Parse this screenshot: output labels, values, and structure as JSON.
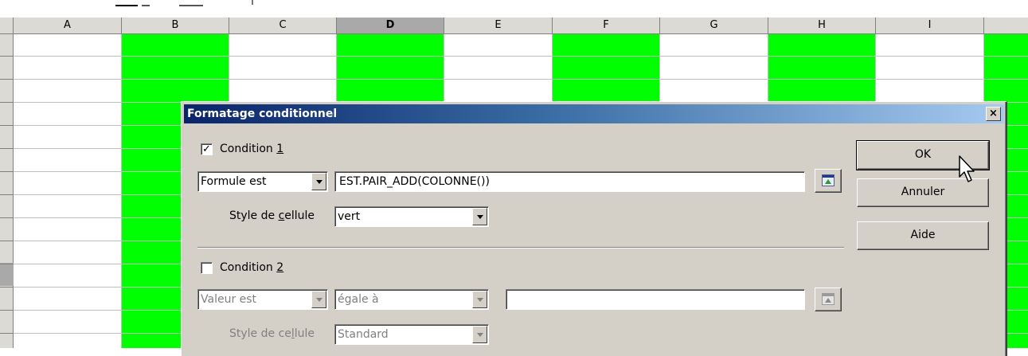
{
  "spreadsheet": {
    "columns": [
      "A",
      "B",
      "C",
      "D",
      "E",
      "F",
      "G",
      "H",
      "I"
    ],
    "selected_column": "D",
    "highlight_color": "#00ff00"
  },
  "dialog": {
    "title": "Formatage conditionnel",
    "close_glyph": "×",
    "condition1": {
      "checked": true,
      "label_pre": "Condition ",
      "label_key": "1",
      "type_value": "Formule est",
      "formula_value": "EST.PAIR_ADD(COLONNE())",
      "style_label_pre": "Style de ",
      "style_label_key": "c",
      "style_label_post": "ellule",
      "style_value": "vert"
    },
    "condition2": {
      "checked": false,
      "label_pre": "Condition ",
      "label_key": "2",
      "type_value": "Valeur est",
      "operator_value": "égale à",
      "value": "",
      "style_label_pre": "Style de ce",
      "style_label_key": "l",
      "style_label_post": "lule",
      "style_value": "Standard"
    },
    "buttons": {
      "ok": "OK",
      "cancel": "Annuler",
      "help": "Aide"
    }
  }
}
